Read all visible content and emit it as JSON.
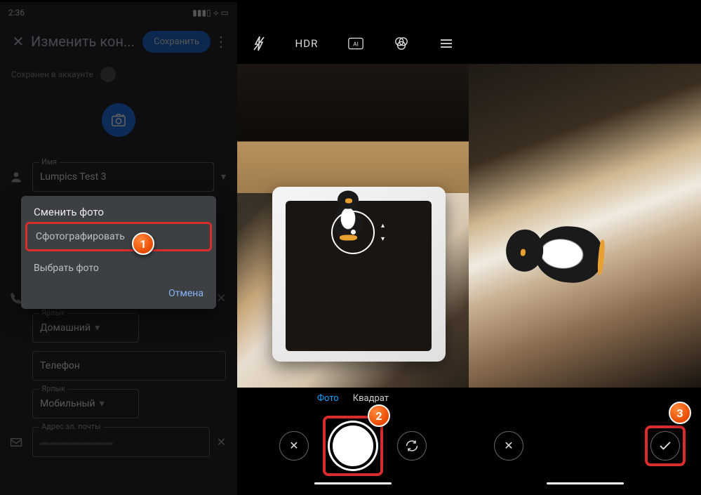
{
  "status": {
    "time": "2:36"
  },
  "header": {
    "title": "Изменить кон...",
    "save": "Сохранить"
  },
  "saved_in": "Сохранен в аккаунте",
  "form": {
    "name_label": "Имя",
    "name_value": "Lumpics Test 3",
    "label_text": "Ярлык",
    "home": "Домашний",
    "phone": "Телефон",
    "mobile": "Мобильный",
    "email": "Адрес эл. почты"
  },
  "dialog": {
    "title": "Сменить фото",
    "take": "Сфотографировать",
    "choose": "Выбрать фото",
    "cancel": "Отмена"
  },
  "camera": {
    "hdr": "HDR",
    "mode_photo": "Фото",
    "mode_square": "Квадрат"
  },
  "badges": {
    "b1": "1",
    "b2": "2",
    "b3": "3"
  }
}
